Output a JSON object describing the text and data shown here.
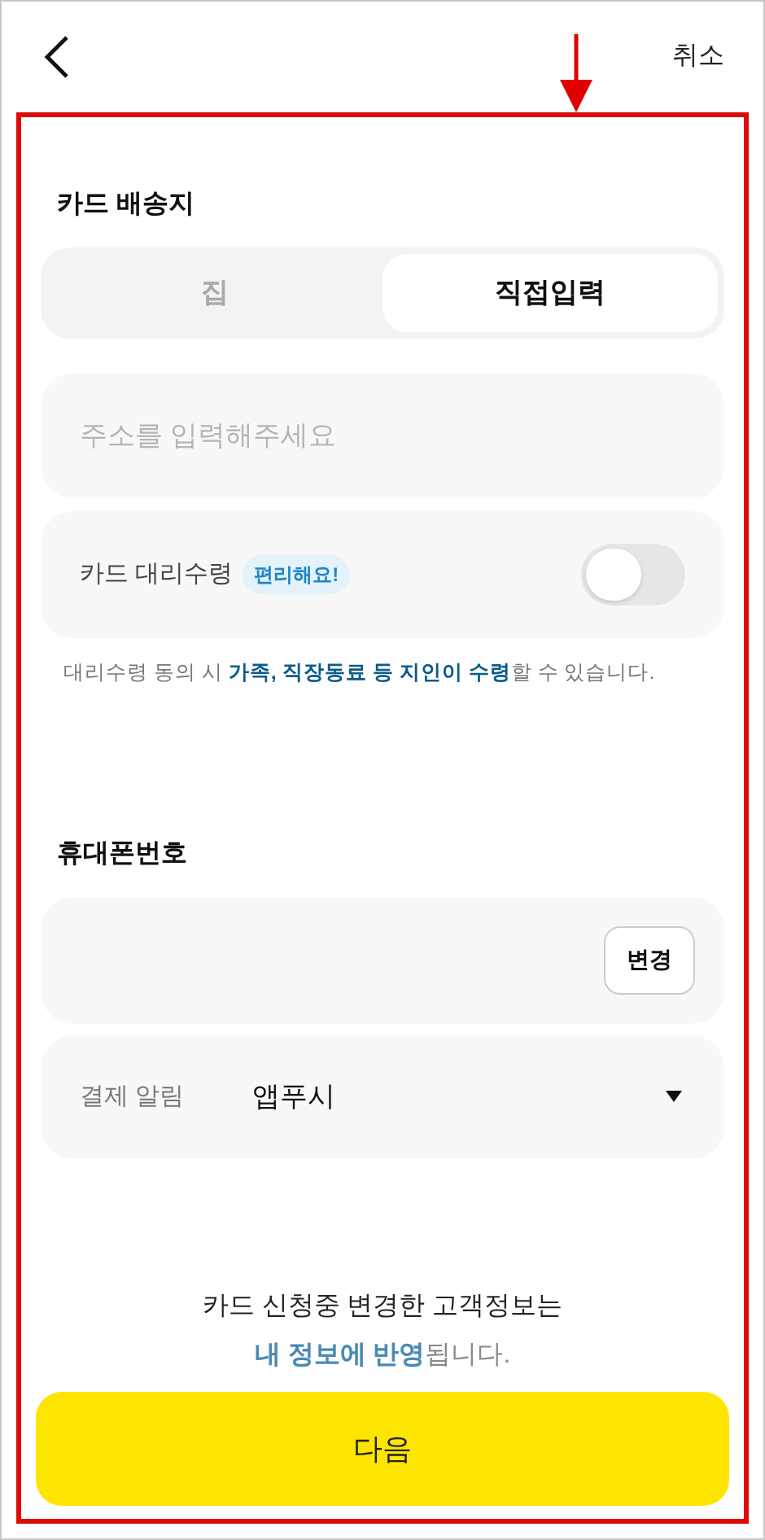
{
  "header": {
    "cancel": "취소"
  },
  "delivery": {
    "title": "카드 배송지",
    "tabs": [
      {
        "label": "집",
        "selected": false
      },
      {
        "label": "직접입력",
        "selected": true
      }
    ],
    "address": {
      "placeholder": "주소를 입력해주세요"
    },
    "proxy": {
      "label": "카드 대리수령",
      "badge": "편리해요!",
      "on": false
    },
    "note": "대리수령 동의 시 **가족, 직장동료 등 지인이 수령**할 수 있습니다."
  },
  "phone": {
    "title": "휴대폰번호",
    "change_button": "변경",
    "payment_alert": {
      "label": "결제 알림",
      "value": "앱푸시"
    }
  },
  "info": [
    "카드 신청중 변경한 고객정보는",
    "**내 정보에 반영**됩니다."
  ],
  "next_button": "다음"
}
